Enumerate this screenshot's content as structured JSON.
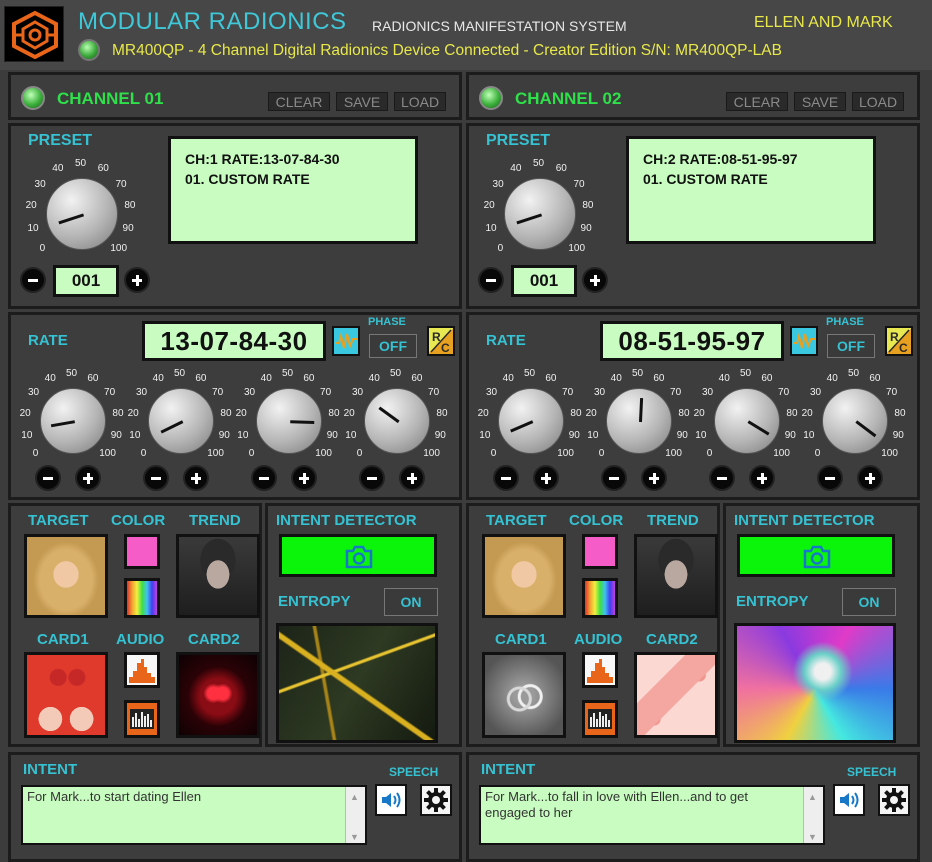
{
  "header": {
    "app_title": "MODULAR RADIONICS",
    "app_subtitle": "RADIONICS MANIFESTATION SYSTEM",
    "user_name": "ELLEN AND MARK",
    "status_text": "MR400QP - 4 Channel Digital Radionics Device Connected  - Creator Edition   S/N: MR400QP-LAB"
  },
  "labels": {
    "clear": "CLEAR",
    "save": "SAVE",
    "load": "LOAD",
    "preset": "PRESET",
    "rate": "RATE",
    "phase": "PHASE",
    "target": "TARGET",
    "color": "COLOR",
    "trend": "TREND",
    "card1": "CARD1",
    "audio": "AUDIO",
    "card2": "CARD2",
    "intent_detector": "INTENT DETECTOR",
    "entropy": "ENTROPY",
    "intent": "INTENT",
    "speech": "SPEECH",
    "off": "OFF",
    "on": "ON"
  },
  "dial_ticks": [
    "0",
    "10",
    "20",
    "30",
    "40",
    "50",
    "60",
    "70",
    "80",
    "90",
    "100"
  ],
  "colors": {
    "accent_cyan": "#35c2d2",
    "lcd_green": "#c8fcc0",
    "led_green": "#2ee04a",
    "title_yellow": "#e8e84a",
    "swatch_pink": "#f55cc8"
  },
  "channels": [
    {
      "title": "CHANNEL 01",
      "lcd_line1": "CH:1  RATE:13-07-84-30",
      "lcd_line2": "01. CUSTOM RATE",
      "preset_number": "001",
      "preset_dial_value": 10,
      "rate_display": "13-07-84-30",
      "rate_dials": [
        13,
        7,
        84,
        30
      ],
      "phase_value": "OFF",
      "entropy_value": "ON",
      "target_image": "blonde-woman-portrait",
      "trend_image": "man-portrait",
      "card1_image": "couple-with-heart-lollipops",
      "card2_image": "neon-heart",
      "entropy_image": "cracked-gold-marble",
      "intent_text": "For Mark...to start dating Ellen"
    },
    {
      "title": "CHANNEL 02",
      "lcd_line1": "CH:2  RATE:08-51-95-97",
      "lcd_line2": "01. CUSTOM RATE",
      "preset_number": "001",
      "preset_dial_value": 10,
      "rate_display": "08-51-95-97",
      "rate_dials": [
        8,
        51,
        95,
        97
      ],
      "phase_value": "OFF",
      "entropy_value": "ON",
      "target_image": "blonde-woman-portrait",
      "trend_image": "man-portrait",
      "card1_image": "wedding-rings",
      "card2_image": "pink-gift-hearts",
      "entropy_image": "iridescent-swirl",
      "intent_text": "For Mark...to fall in love with Ellen...and to get engaged to her"
    }
  ]
}
